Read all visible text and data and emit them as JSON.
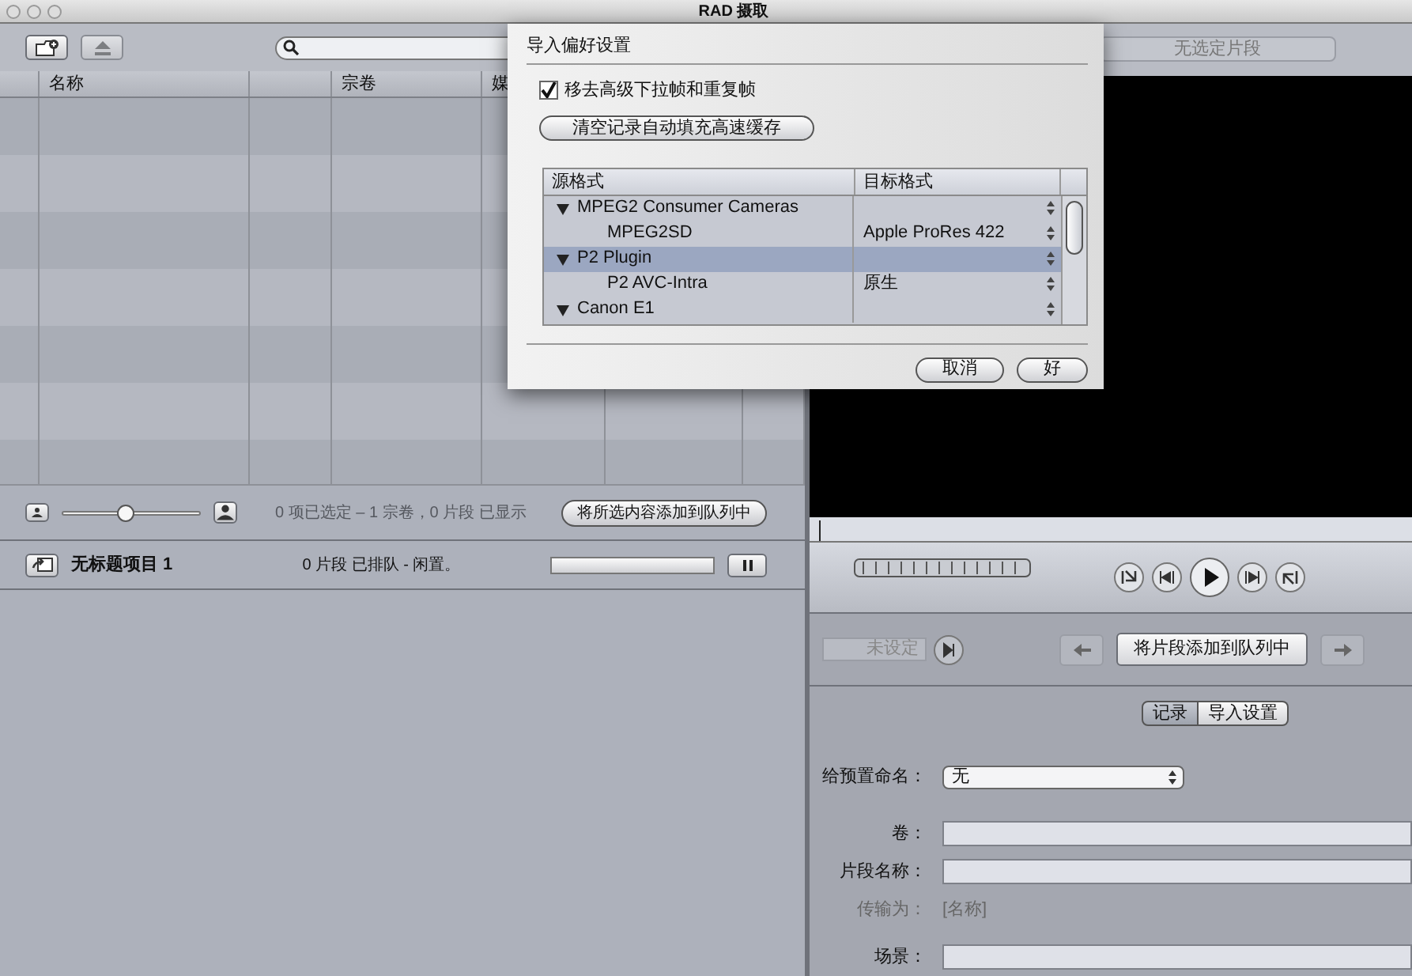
{
  "window": {
    "title": "RAD 摄取"
  },
  "clip_table": {
    "columns": [
      {
        "label": "名称"
      },
      {
        "label": "宗卷"
      },
      {
        "label": "媒"
      }
    ]
  },
  "browser_footer": {
    "thumbnail_slider": {
      "level": 0.45
    },
    "status": "0 项已选定 – 1 宗卷，0 片段 已显示",
    "add_button": "将所选内容添加到队列中"
  },
  "project_bar": {
    "name": "无标题项目 1",
    "status": "0 片段 已排队 - 闲置。",
    "progress": {
      "level": 0
    }
  },
  "viewer": {
    "clip_field": {
      "placeholder": "无选定片段"
    }
  },
  "mark_in": {
    "placeholder": "未设定"
  },
  "queue_button": "将片段添加到队列中",
  "tabs": [
    {
      "label": "记录",
      "selected": true
    },
    {
      "label": "导入设置",
      "selected": false
    }
  ],
  "form": {
    "fields": [
      {
        "label": "给预置命名：",
        "kind": "select",
        "value": "无"
      },
      {
        "label": "卷：",
        "kind": "input"
      },
      {
        "label": "片段名称：",
        "kind": "input"
      },
      {
        "label": "传输为：",
        "kind": "static",
        "value": "[名称]"
      },
      {
        "label": "场景：",
        "kind": "input"
      }
    ]
  },
  "dialog": {
    "title": "导入偏好设置",
    "checkbox": {
      "label": "移去高级下拉帧和重复帧",
      "checked": true
    },
    "clear_button": "清空记录自动填充高速缓存",
    "table": {
      "columns": [
        "源格式",
        "目标格式"
      ],
      "rows": [
        {
          "source": "MPEG2 Consumer Cameras",
          "expanded": true,
          "selected": false,
          "children": [
            {
              "source": "MPEG2SD",
              "target": "Apple ProRes 422",
              "selected": false
            }
          ]
        },
        {
          "source": "P2 Plugin",
          "expanded": true,
          "selected": true,
          "children": [
            {
              "source": "P2 AVC-Intra",
              "target": "原生",
              "selected": false
            }
          ]
        },
        {
          "source": "Canon E1",
          "expanded": true,
          "selected": false,
          "children": []
        }
      ]
    },
    "buttons": [
      "取消",
      "好"
    ]
  }
}
